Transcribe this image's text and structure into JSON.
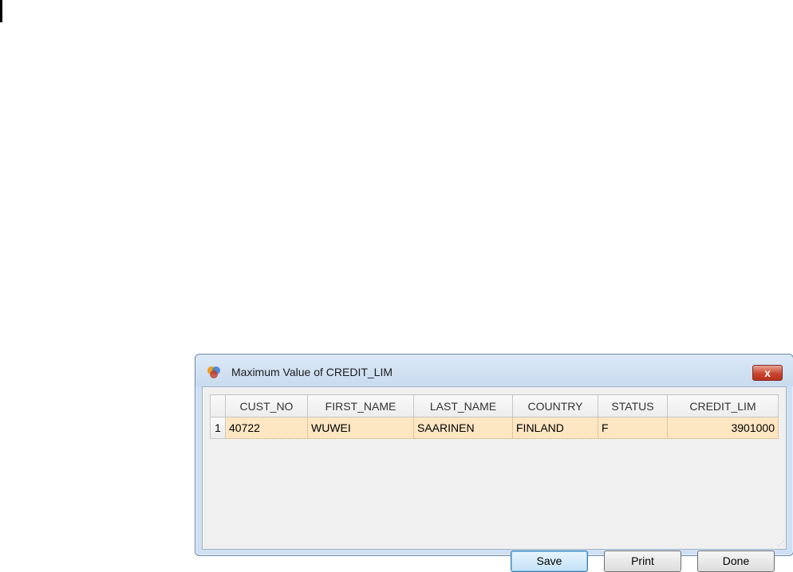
{
  "window": {
    "title": "Maximum Value of CREDIT_LIM",
    "close_label": "x",
    "icon": "app-icon"
  },
  "grid": {
    "columns": [
      "CUST_NO",
      "FIRST_NAME",
      "LAST_NAME",
      "COUNTRY",
      "STATUS",
      "CREDIT_LIM"
    ],
    "rows": [
      {
        "row_number": "1",
        "cells": [
          "40722",
          "WUWEI",
          "SAARINEN",
          "FINLAND",
          "F",
          "3901000"
        ]
      }
    ]
  },
  "buttons": {
    "save": "Save",
    "print": "Print",
    "done": "Done"
  },
  "colors": {
    "selected_row": "#fde6c2",
    "titlebar": "#cfe0f3",
    "close_button": "#c9452f"
  }
}
